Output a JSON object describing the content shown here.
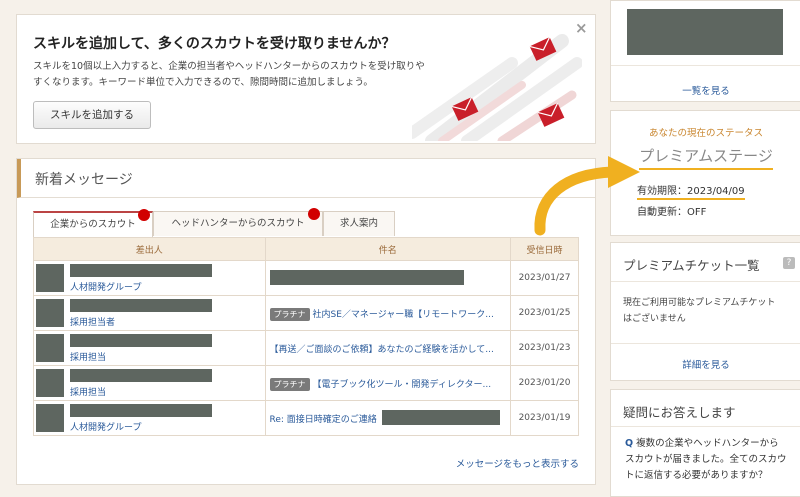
{
  "promo": {
    "title": "スキルを追加して、多くのスカウトを受け取りませんか？",
    "desc_line1": "スキルを10個以上入力すると、企業の担当者やヘッドハンターからのスカウトを受け取りや",
    "desc_line2": "すくなります。キーワード単位で入力できるので、隙間時間に追加しましょう。",
    "button": "スキルを追加する",
    "close": "×"
  },
  "messages": {
    "heading": "新着メッセージ",
    "tabs": [
      "企業からのスカウト",
      "ヘッドハンターからのスカウト",
      "求人案内"
    ],
    "columns": [
      "差出人",
      "件名",
      "受信日時"
    ],
    "rows": [
      {
        "sender": "人材開発グループ",
        "badge": "",
        "subject": "",
        "date": "2023/01/27"
      },
      {
        "sender": "採用担当者",
        "badge": "プラチナ",
        "subject": "社内SE／マネージャー職【リモートワーク...",
        "date": "2023/01/25"
      },
      {
        "sender": "採用担当",
        "badge": "",
        "subject": "【再送／ご面談のご依頼】あなたのご経験を活かして...",
        "date": "2023/01/23"
      },
      {
        "sender": "採用担当",
        "badge": "プラチナ",
        "subject": "【電子ブック化ツール・開発ディレクター...",
        "date": "2023/01/20"
      },
      {
        "sender": "人材開発グループ",
        "badge": "",
        "subject": "Re: 面接日時確定のご連絡",
        "date": "2023/01/19"
      }
    ],
    "more": "メッセージをもっと表示する"
  },
  "sidebar": {
    "top_link": "一覧を見る",
    "status_label": "あなたの現在のステータス",
    "status_value": "プレミアムステージ",
    "expiry": "有効期限：2023/04/09",
    "auto_renew": "自動更新：OFF",
    "tickets_title": "プレミアムチケット一覧",
    "help_glyph": "?",
    "tickets_text_1": "現在ご利用可能なプレミアムチケット",
    "tickets_text_2": "はございません",
    "tickets_link": "詳細を見る",
    "faq_title": "疑問にお答えします",
    "faq_q_mark": "Q",
    "faq_q_1": "複数の企業やヘッドハンターから",
    "faq_q_2": "スカウトが届きました。全てのスカウ",
    "faq_q_3": "トに返信する必要がありますか？"
  },
  "colors": {
    "accent_orange": "#f0b020",
    "tab_dot": "#d10000",
    "link": "#2a5a9a"
  }
}
